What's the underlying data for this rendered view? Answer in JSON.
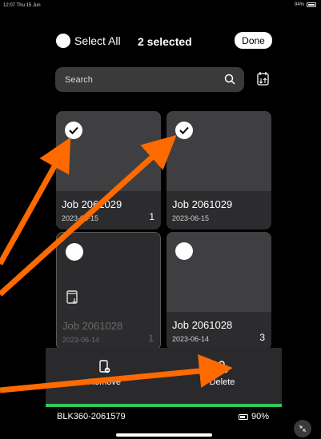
{
  "status_bar": {
    "time": "12:07  Thu 15 Jun",
    "battery_percent": "94%"
  },
  "header": {
    "select_all_label": "Select All",
    "selected_count": "2 selected",
    "done_label": "Done"
  },
  "search": {
    "placeholder": "Search",
    "icon": "search-icon"
  },
  "jobs": [
    {
      "title": "Job 2061029",
      "date": "2023-06-15",
      "count": "1",
      "selected": true
    },
    {
      "title": "Job 2061029",
      "date": "2023-06-15",
      "count": "",
      "selected": true
    },
    {
      "title": "Job 2061028",
      "date": "2023-06-14",
      "count": "1",
      "selected": false
    },
    {
      "title": "Job 2061028",
      "date": "2023-06-14",
      "count": "3",
      "selected": false
    }
  ],
  "actions": {
    "remove_label": "Remove",
    "delete_label": "Delete"
  },
  "device": {
    "name": "BLK360-2061579",
    "battery": "90%"
  },
  "colors": {
    "accent_green": "#34c759",
    "annotation_arrow": "#ff6a00"
  }
}
